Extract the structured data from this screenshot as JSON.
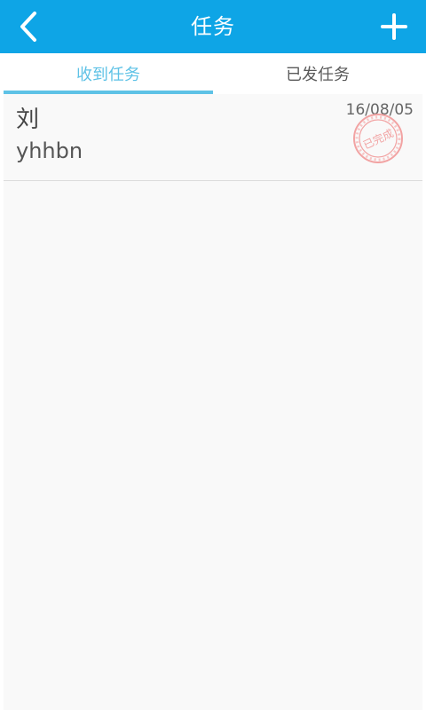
{
  "header": {
    "title": "任务",
    "back_icon": "chevron-left-icon",
    "add_icon": "plus-icon",
    "background_color": "#0ea5e6"
  },
  "tabs": [
    {
      "label": "收到任务",
      "active": true
    },
    {
      "label": "已发任务",
      "active": false
    }
  ],
  "accent_color": "#5ec2e6",
  "tasks": [
    {
      "name": "刘",
      "content": "yhhbn",
      "date": "16/08/05",
      "stamp": {
        "text": "已完成",
        "icon": "completed-stamp-icon",
        "color": "#f2a3a3"
      }
    }
  ]
}
